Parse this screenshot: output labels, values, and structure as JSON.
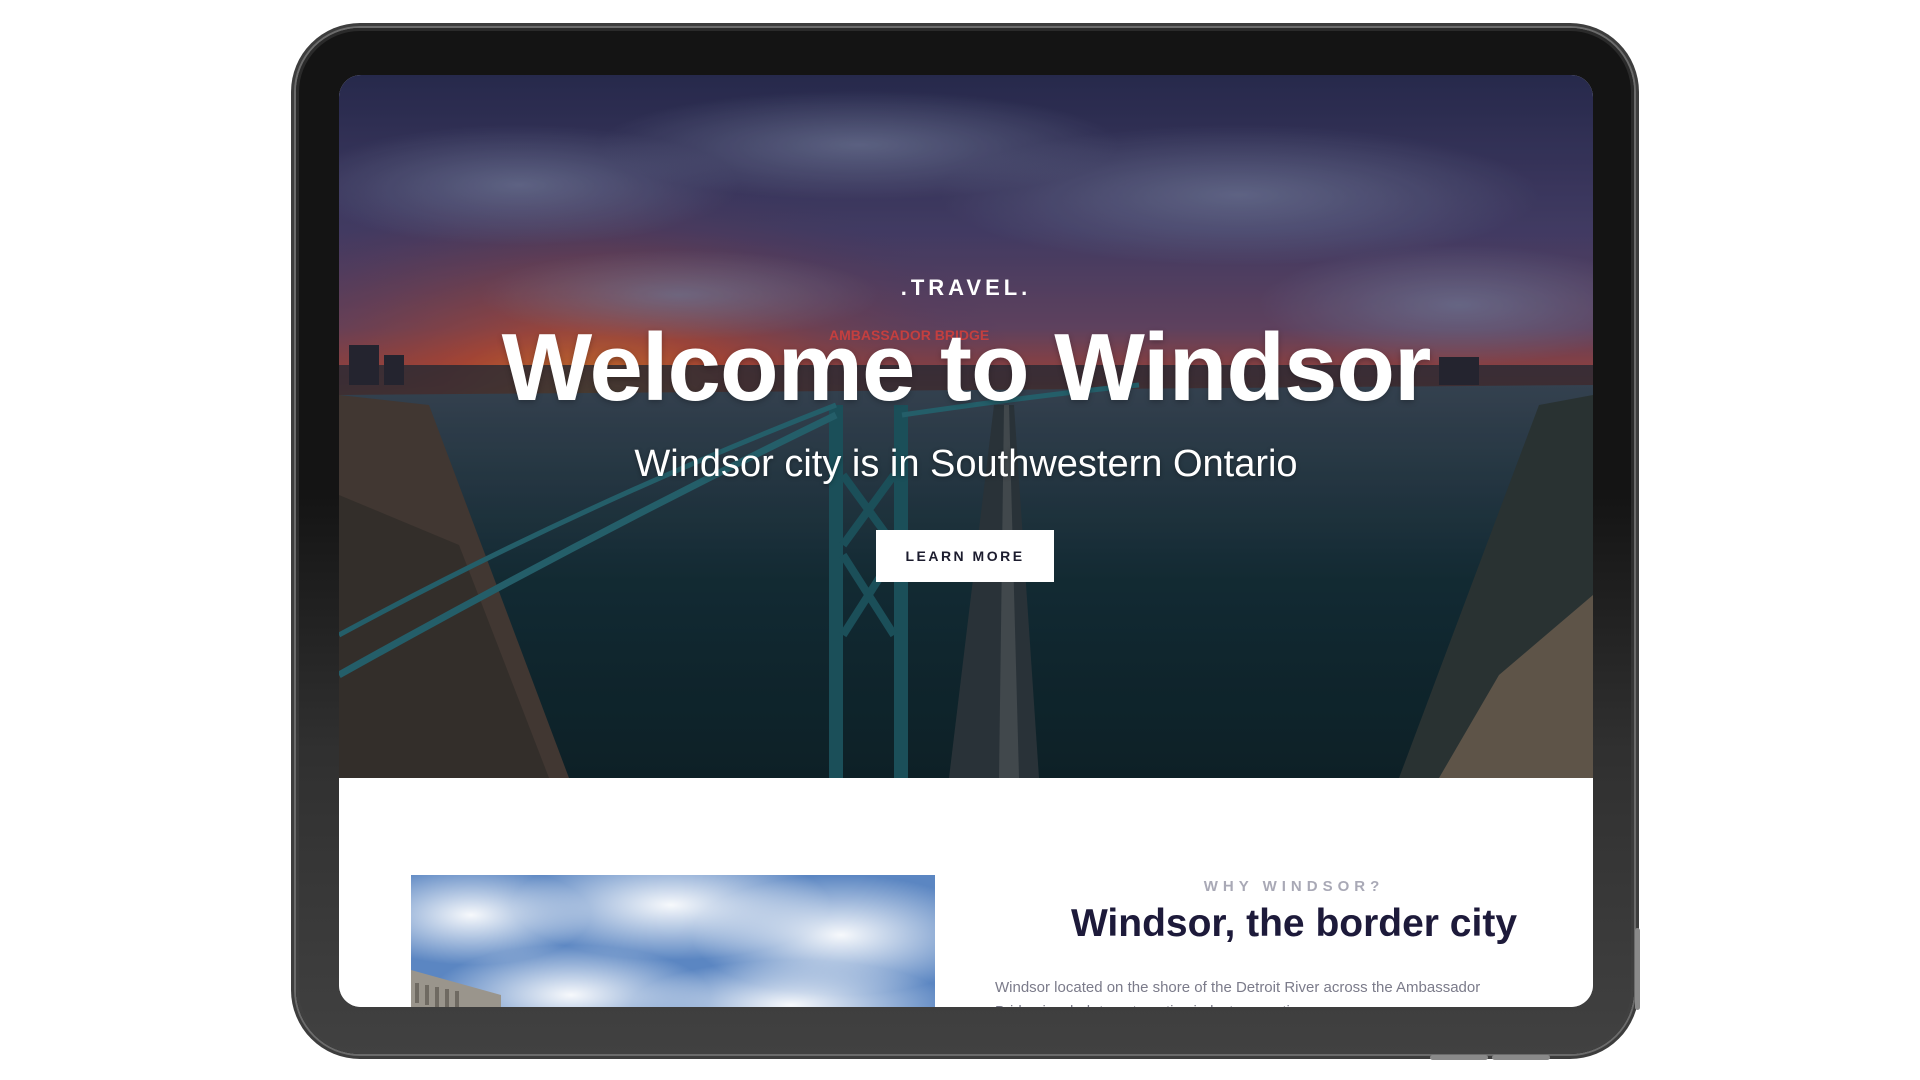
{
  "hero": {
    "eyebrow": ".TRAVEL.",
    "title": "Welcome to Windsor",
    "subtitle": "Windsor city is in Southwestern Ontario",
    "button_label": "LEARN MORE",
    "sign_text": "AMBASSADOR BRIDGE"
  },
  "why": {
    "eyebrow": "WHY WINDSOR?",
    "title": "Windsor, the border city",
    "body": "Windsor located on the shore of the Detroit River across the Ambassador Bridge is a hub to automotive industry, creative"
  },
  "colors": {
    "page_background": "#ffffff",
    "device_frame": "#141414",
    "title_dark": "#1d1a3a",
    "eyebrow_gray": "#a9a9b6",
    "body_gray": "#7b7b8a"
  }
}
